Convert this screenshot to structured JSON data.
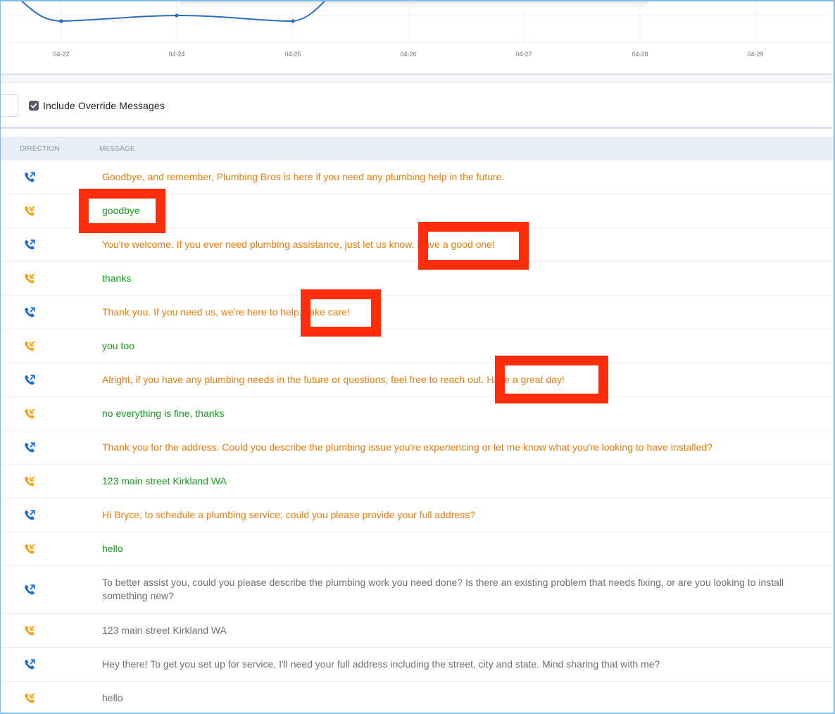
{
  "chart_data": {
    "type": "line",
    "categories": [
      "04-22",
      "04-24",
      "04-25",
      "04-26",
      "04-27",
      "04-28",
      "04-29"
    ],
    "series": [
      {
        "color": "#2b6cc4"
      }
    ],
    "grid": true,
    "cropped": true
  },
  "filters": {
    "include_override_label": "Include Override Messages",
    "include_override_checked": true
  },
  "table": {
    "headers": {
      "direction": "DIRECTION",
      "message": "MESSAGE"
    },
    "rows": [
      {
        "direction": "outbound",
        "tone": "out",
        "message": "Goodbye, and remember, Plumbing Bros is here if you need any plumbing help in the future."
      },
      {
        "direction": "inbound",
        "tone": "in",
        "message": "goodbye"
      },
      {
        "direction": "outbound",
        "tone": "out",
        "message": "You're welcome. If you ever need plumbing assistance, just let us know. Have a good one!"
      },
      {
        "direction": "inbound",
        "tone": "in",
        "message": "thanks"
      },
      {
        "direction": "outbound",
        "tone": "out",
        "message": "Thank you. If you need us, we're here to help. Take care!"
      },
      {
        "direction": "inbound",
        "tone": "in",
        "message": "you too"
      },
      {
        "direction": "outbound",
        "tone": "out",
        "message": "Alright, if you have any plumbing needs in the future or questions, feel free to reach out. Have a great day!"
      },
      {
        "direction": "inbound",
        "tone": "in",
        "message": "no everything is fine, thanks"
      },
      {
        "direction": "outbound",
        "tone": "out",
        "message": "Thank you for the address. Could you describe the plumbing issue you're experiencing or let me know what you're looking to have installed?"
      },
      {
        "direction": "inbound",
        "tone": "in",
        "message": "123 main street Kirkland WA"
      },
      {
        "direction": "outbound",
        "tone": "out",
        "message": "Hi Bryce, to schedule a plumbing service, could you please provide your full address?"
      },
      {
        "direction": "inbound",
        "tone": "in",
        "message": "hello"
      },
      {
        "direction": "outbound",
        "tone": "gray",
        "message": "To better assist you, could you please describe the plumbing work you need done? Is there an existing problem that needs fixing, or are you looking to install something new?"
      },
      {
        "direction": "inbound",
        "tone": "gray",
        "message": "123 main street Kirkland WA"
      },
      {
        "direction": "outbound",
        "tone": "gray",
        "message": "Hey there! To get you set up for service, I'll need your full address including the street, city and state. Mind sharing that with me?"
      },
      {
        "direction": "inbound",
        "tone": "gray",
        "message": "hello"
      }
    ]
  },
  "colors": {
    "outbound_icon": "#1e6fd0",
    "inbound_icon": "#f2a615",
    "outbound_text": "#ef7d0d",
    "inbound_text": "#169c1d",
    "override_text": "#6c7178",
    "highlight_box": "#ff2d09"
  },
  "icons": {
    "outbound": "phone-outgoing-icon",
    "inbound": "phone-incoming-icon"
  }
}
